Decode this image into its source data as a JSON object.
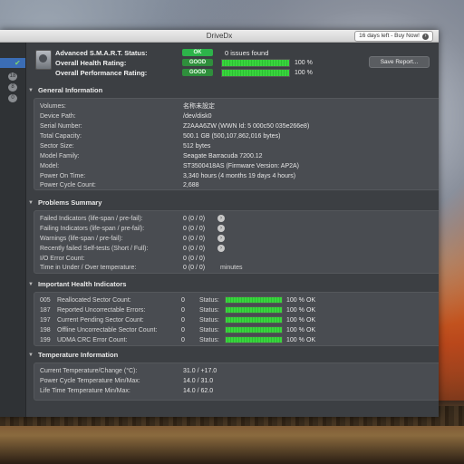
{
  "window": {
    "title": "DriveDx",
    "trial_button": "16 days left - Buy Now!",
    "trial_icon": "arrow-right-circle-icon"
  },
  "sidebar": {
    "badges": [
      "18",
      "8",
      "0"
    ]
  },
  "status": {
    "rows": [
      {
        "label": "Advanced S.M.A.R.T. Status:",
        "pill": "OK",
        "text": "0 issues found"
      },
      {
        "label": "Overall Health Rating:",
        "pill": "GOOD",
        "percent": "100 %",
        "value": 1.0
      },
      {
        "label": "Overall Performance Rating:",
        "pill": "GOOD",
        "percent": "100 %",
        "value": 1.0
      }
    ],
    "save_report": "Save Report..."
  },
  "general": {
    "title": "General Information",
    "rows": [
      {
        "label": "Volumes:",
        "value": "名称未設定"
      },
      {
        "label": "Device Path:",
        "value": "/dev/disk0"
      },
      {
        "label": "Serial Number:",
        "value": "Z2AAA6ZW (WWN Id: 5 000c50 035e266e8)"
      },
      {
        "label": "Total Capacity:",
        "value": "500.1 GB (500,107,862,016 bytes)"
      },
      {
        "label": "Sector Size:",
        "value": "512 bytes"
      },
      {
        "label": "Model Family:",
        "value": "Seagate Barracuda 7200.12"
      },
      {
        "label": "Model:",
        "value": "ST3500418AS  (Firmware Version: AP2A)"
      },
      {
        "label": "Power On Time:",
        "value": "3,340 hours (4 months 19 days 4 hours)"
      },
      {
        "label": "Power Cycle Count:",
        "value": "2,688"
      }
    ]
  },
  "problems": {
    "title": "Problems Summary",
    "rows": [
      {
        "label": "Failed Indicators (life-span / pre-fail):",
        "value": "0 (0 / 0)",
        "arrow": true
      },
      {
        "label": "Failing Indicators (life-span / pre-fail):",
        "value": "0 (0 / 0)",
        "arrow": true
      },
      {
        "label": "Warnings (life-span / pre-fail):",
        "value": "0 (0 / 0)",
        "arrow": true
      },
      {
        "label": "Recently failed Self-tests (Short / Full):",
        "value": "0 (0 / 0)",
        "arrow": true
      },
      {
        "label": "I/O Error Count:",
        "value": "0 (0 / 0)",
        "arrow": false
      },
      {
        "label": "Time in Under / Over temperature:",
        "value": "0 (0 / 0)",
        "arrow": false,
        "unit": "minutes"
      }
    ]
  },
  "health": {
    "title": "Important Health Indicators",
    "status_label": "Status:",
    "rows": [
      {
        "id": "005",
        "name": "Reallocated Sector Count:",
        "num": "0",
        "percent": "100 %",
        "value": 1.0,
        "ok": "OK"
      },
      {
        "id": "187",
        "name": "Reported Uncorrectable Errors:",
        "num": "0",
        "percent": "100 %",
        "value": 1.0,
        "ok": "OK"
      },
      {
        "id": "197",
        "name": "Current Pending Sector Count:",
        "num": "0",
        "percent": "100 %",
        "value": 1.0,
        "ok": "OK"
      },
      {
        "id": "198",
        "name": "Offline Uncorrectable Sector Count:",
        "num": "0",
        "percent": "100 %",
        "value": 1.0,
        "ok": "OK"
      },
      {
        "id": "199",
        "name": "UDMA CRC Error Count:",
        "num": "0",
        "percent": "100 %",
        "value": 1.0,
        "ok": "OK"
      }
    ]
  },
  "temperature": {
    "title": "Temperature Information",
    "rows": [
      {
        "label": "Current Temperature/Change (°C):",
        "value": "31.0 / +17.0"
      },
      {
        "label": "Power Cycle Temperature Min/Max:",
        "value": "14.0 / 31.0"
      },
      {
        "label": "Life Time Temperature Min/Max:",
        "value": "14.0 / 62.0"
      }
    ]
  }
}
